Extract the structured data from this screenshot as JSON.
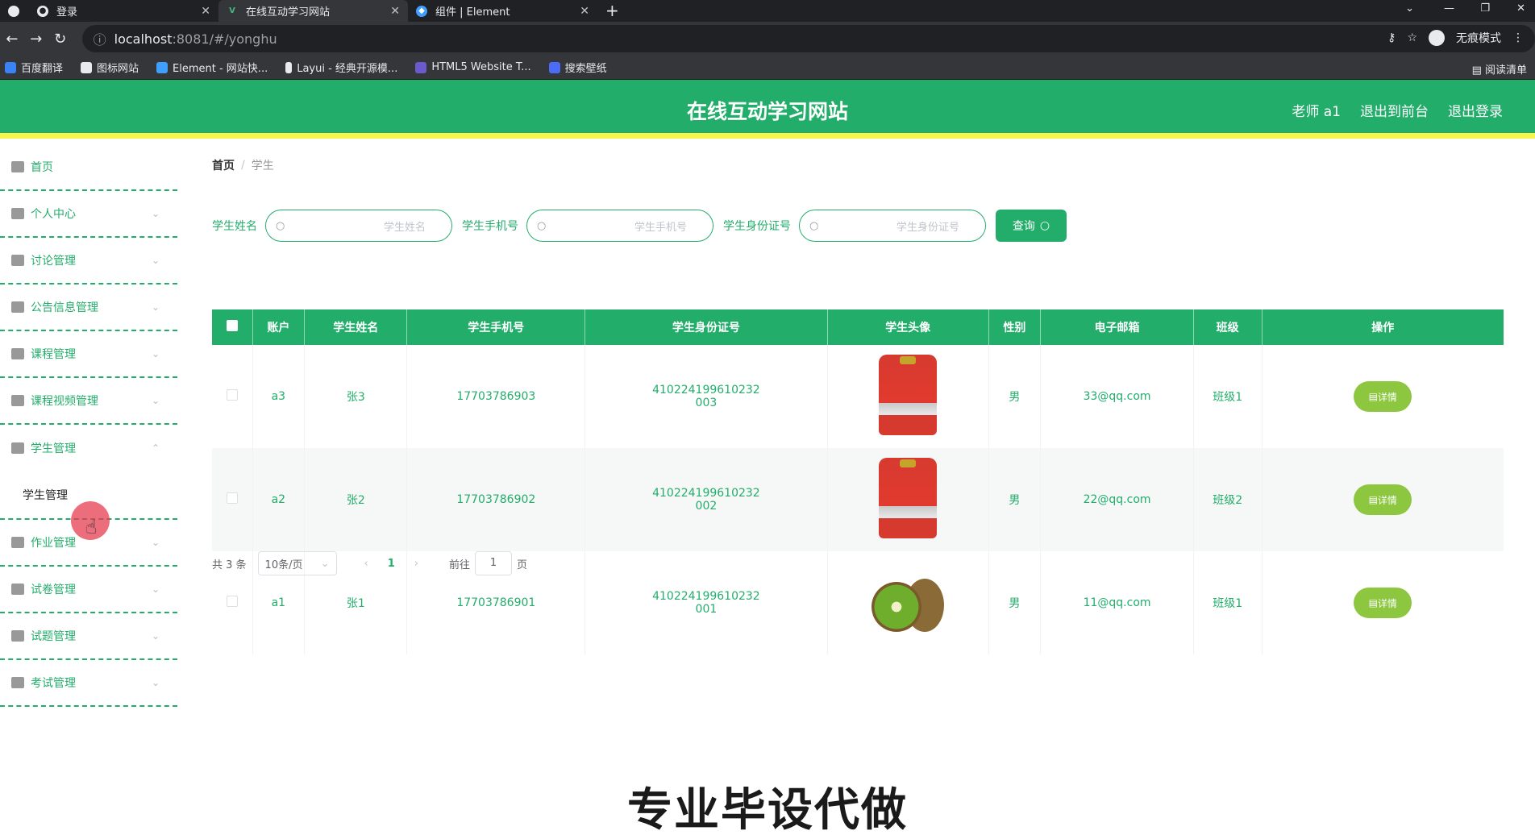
{
  "browser": {
    "tabs": [
      {
        "title": "登录",
        "active": false
      },
      {
        "title": "在线互动学习网站",
        "active": true
      },
      {
        "title": "组件 | Element",
        "active": false
      }
    ],
    "url_host": "localhost",
    "url_rest": ":8081/#/yonghu",
    "profile_label": "无痕模式",
    "bookmarks": [
      "百度翻译",
      "图标网站",
      "Element - 网站快...",
      "Layui - 经典开源模...",
      "HTML5 Website T...",
      "搜索壁纸"
    ],
    "reading_list": "阅读清单"
  },
  "header": {
    "title": "在线互动学习网站",
    "user": "老师 a1",
    "to_front": "退出到前台",
    "logout": "退出登录",
    "brand_color": "#23ad6b",
    "accent_strip": "#f5f54a"
  },
  "sidebar": {
    "items": [
      {
        "label": "首页",
        "icon": "home-icon"
      },
      {
        "label": "个人中心",
        "icon": "user-icon"
      },
      {
        "label": "讨论管理",
        "icon": "chat-icon"
      },
      {
        "label": "公告信息管理",
        "icon": "megaphone-icon"
      },
      {
        "label": "课程管理",
        "icon": "expand-icon"
      },
      {
        "label": "课程视频管理",
        "icon": "send-icon"
      },
      {
        "label": "学生管理",
        "icon": "card-icon",
        "expanded": true,
        "sub": [
          "学生管理"
        ]
      },
      {
        "label": "作业管理",
        "icon": "target-icon"
      },
      {
        "label": "试卷管理",
        "icon": "comment-icon"
      },
      {
        "label": "试题管理",
        "icon": "doc-icon"
      },
      {
        "label": "考试管理",
        "icon": "chart-icon"
      }
    ]
  },
  "breadcrumb": {
    "home": "首页",
    "current": "学生"
  },
  "search": {
    "name_label": "学生姓名",
    "name_placeholder": "学生姓名",
    "phone_label": "学生手机号",
    "phone_placeholder": "学生手机号",
    "id_label": "学生身份证号",
    "id_placeholder": "学生身份证号",
    "query_button": "查询"
  },
  "table": {
    "headers": [
      "账户",
      "学生姓名",
      "学生手机号",
      "学生身份证号",
      "学生头像",
      "性别",
      "电子邮箱",
      "班级",
      "操作"
    ],
    "rows": [
      {
        "account": "a3",
        "name": "张3",
        "phone": "17703786903",
        "id1": "410224199610232",
        "id2": "003",
        "avatar": "rice-bag",
        "gender": "男",
        "email": "33@qq.com",
        "class": "班级1",
        "action": "详情"
      },
      {
        "account": "a2",
        "name": "张2",
        "phone": "17703786902",
        "id1": "410224199610232",
        "id2": "002",
        "avatar": "rice-bag",
        "gender": "男",
        "email": "22@qq.com",
        "class": "班级2",
        "action": "详情"
      },
      {
        "account": "a1",
        "name": "张1",
        "phone": "17703786901",
        "id1": "410224199610232",
        "id2": "001",
        "avatar": "kiwi",
        "gender": "男",
        "email": "11@qq.com",
        "class": "班级1",
        "action": "详情"
      }
    ]
  },
  "pagination": {
    "total": "共 3 条",
    "page_size": "10条/页",
    "current_page": "1",
    "goto_label": "前往",
    "goto_value": "1",
    "page_suffix": "页"
  },
  "overlay_text": "专业毕设代做"
}
